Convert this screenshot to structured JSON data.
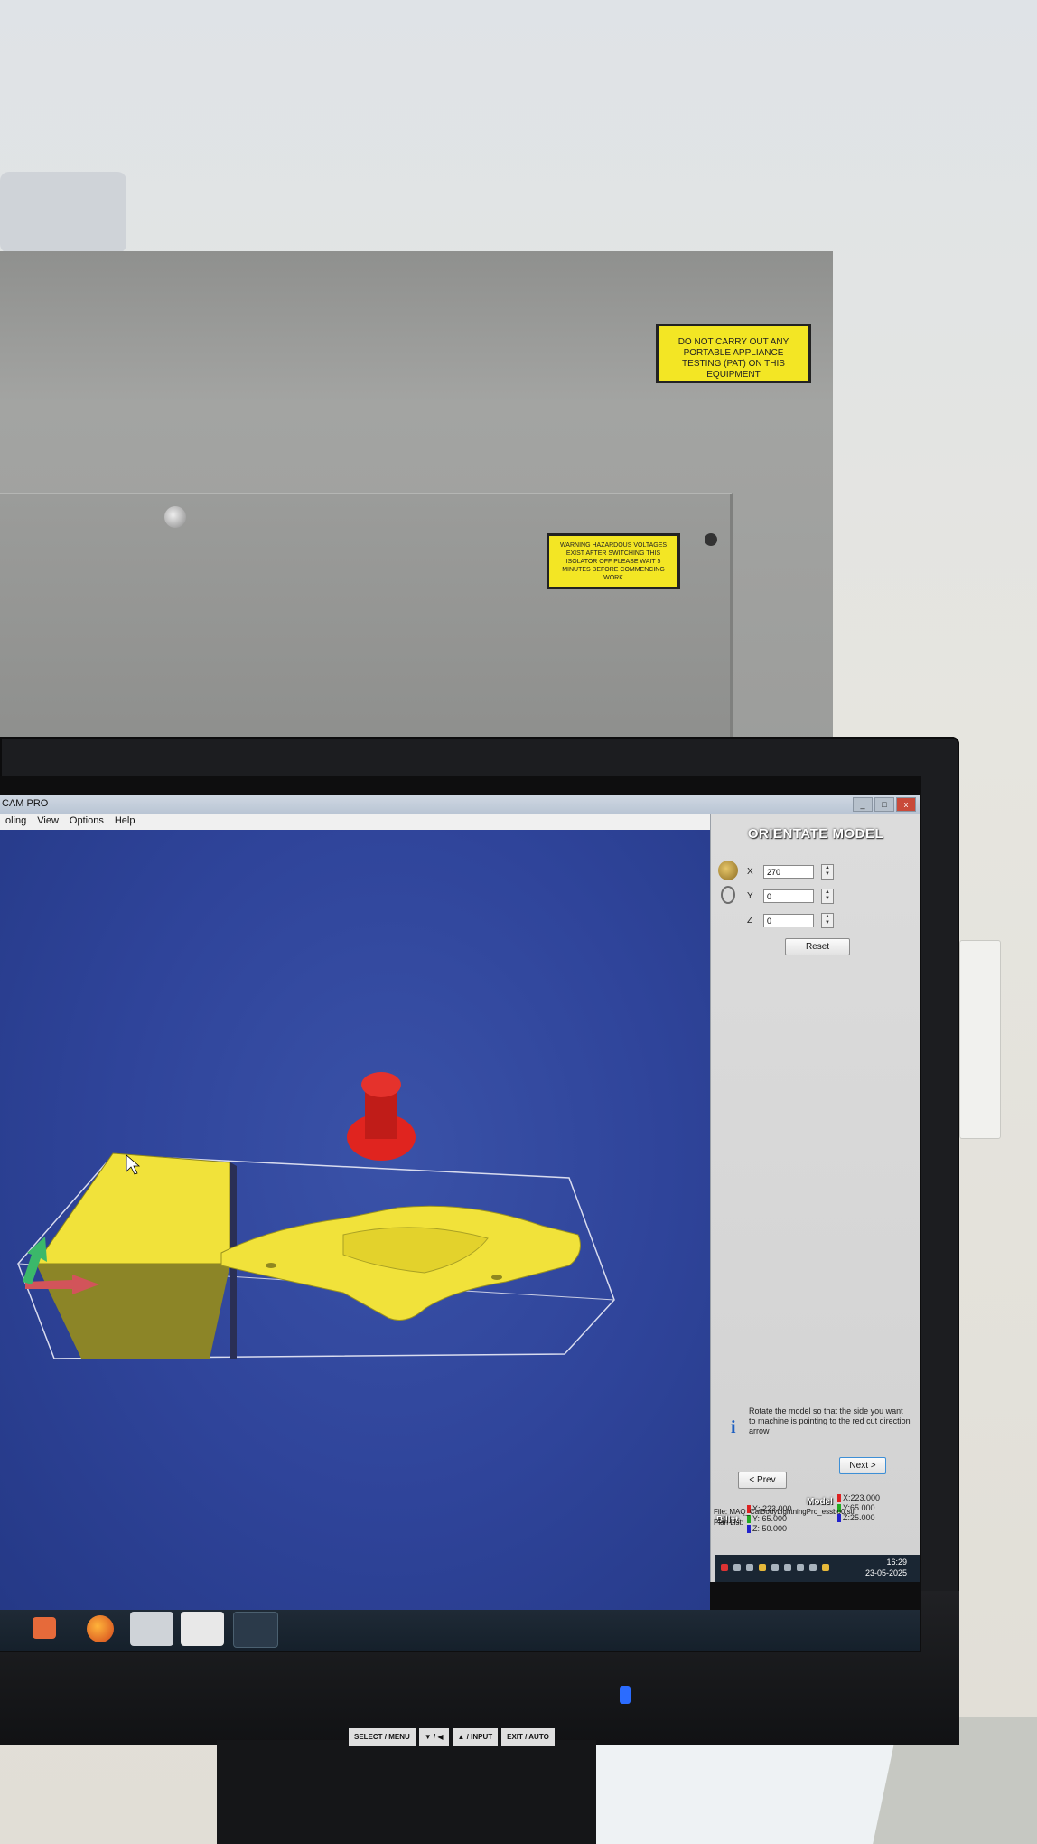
{
  "warning_labels": {
    "pat": "DO NOT CARRY OUT ANY PORTABLE APPLIANCE TESTING (PAT) ON THIS EQUIPMENT",
    "hazard": "WARNING HAZARDOUS VOLTAGES EXIST AFTER SWITCHING THIS ISOLATOR OFF PLEASE WAIT 5 MINUTES BEFORE COMMENCING WORK"
  },
  "app": {
    "title": "CAM PRO",
    "window_buttons": [
      "_",
      "□",
      "x"
    ],
    "menu": [
      "oling",
      "View",
      "Options",
      "Help"
    ]
  },
  "panel": {
    "heading": "ORIENTATE MODEL",
    "axes": [
      {
        "label": "X",
        "value": "270"
      },
      {
        "label": "Y",
        "value": "0"
      },
      {
        "label": "Z",
        "value": "0"
      }
    ],
    "reset_label": "Reset",
    "info": "Rotate the model so that the side you want to machine is pointing to the red cut direction arrow",
    "prev_label": "< Prev",
    "next_label": "Next >",
    "billet_label": "Billet",
    "model_label": "Model",
    "billet": [
      "X: 223.000",
      "Y: 65.000",
      "Z: 50.000"
    ],
    "model": [
      "X:223.000",
      "Y:65.000",
      "Z:25.000"
    ],
    "file": "File: MAQ_CalBodyLightningPro_essbo0.stl",
    "plan_list": "Plan List:"
  },
  "clock": {
    "time": "16:29",
    "date": "23-05-2025"
  },
  "monitor_osd": [
    "SELECT / MENU",
    "▼ / ◀",
    "▲ / INPUT",
    "EXIT / AUTO"
  ],
  "taskbar_icons": [
    "media-player-icon",
    "firefox-icon",
    "cnc-machine-icon",
    "qc-pro-icon",
    "autodesk-icon"
  ],
  "colors": {
    "viewport_blue": "#2f449a",
    "model_yellow": "#f1e23a",
    "marker_red": "#e0241f",
    "label_yellow": "#f3e624"
  }
}
